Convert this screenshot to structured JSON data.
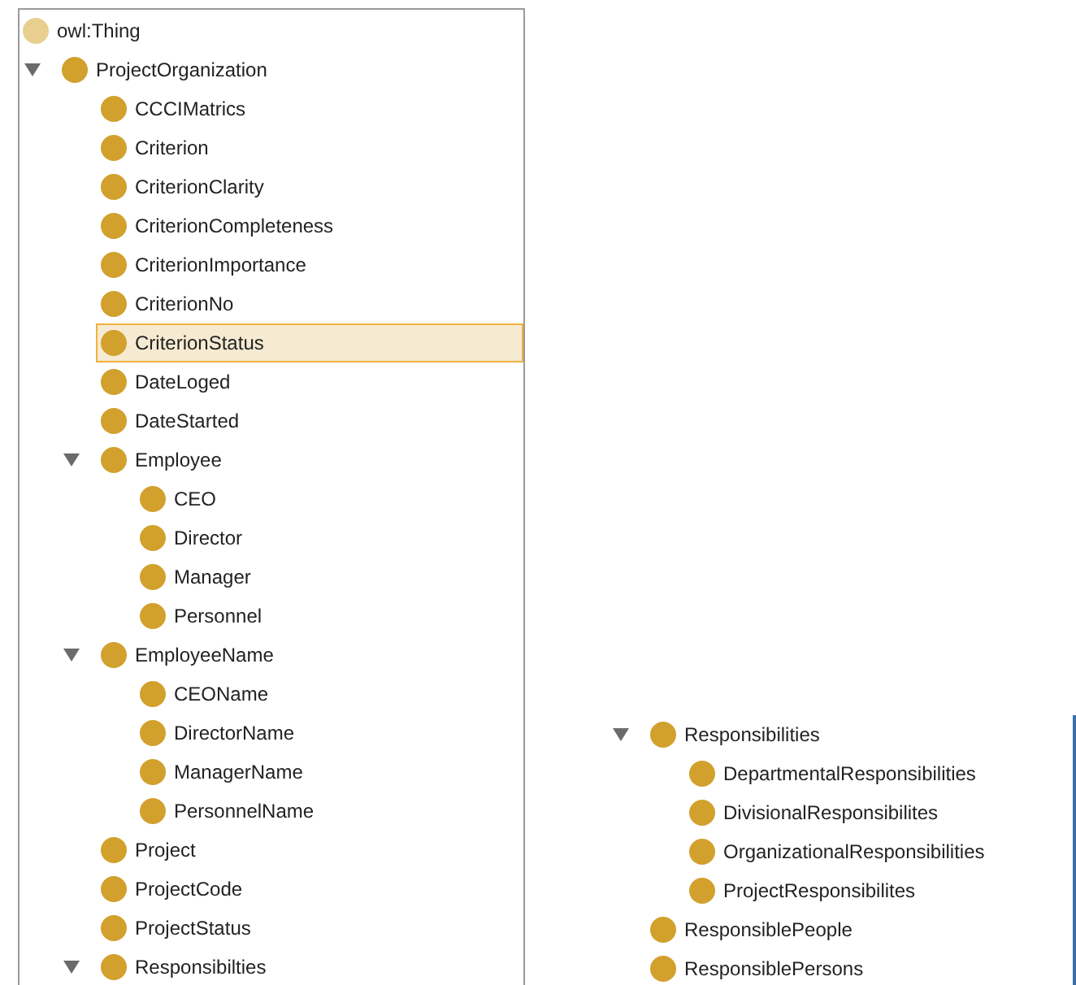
{
  "class_tree": [
    {
      "label": "owl:Thing",
      "kind": "root",
      "selected": false
    },
    {
      "label": "ProjectOrganization",
      "kind": "class",
      "selected": false,
      "expanded": true,
      "children": [
        {
          "label": "CCCIMatrics",
          "kind": "class",
          "selected": false
        },
        {
          "label": "Criterion",
          "kind": "class",
          "selected": false
        },
        {
          "label": "CriterionClarity",
          "kind": "class",
          "selected": false
        },
        {
          "label": "CriterionCompleteness",
          "kind": "class",
          "selected": false
        },
        {
          "label": "CriterionImportance",
          "kind": "class",
          "selected": false
        },
        {
          "label": "CriterionNo",
          "kind": "class",
          "selected": false
        },
        {
          "label": "CriterionStatus",
          "kind": "class",
          "selected": true
        },
        {
          "label": "DateLoged",
          "kind": "class",
          "selected": false
        },
        {
          "label": "DateStarted",
          "kind": "class",
          "selected": false
        },
        {
          "label": "Employee",
          "kind": "class",
          "selected": false,
          "expanded": true,
          "children": [
            {
              "label": "CEO",
              "kind": "class",
              "selected": false
            },
            {
              "label": "Director",
              "kind": "class",
              "selected": false
            },
            {
              "label": "Manager",
              "kind": "class",
              "selected": false
            },
            {
              "label": "Personnel",
              "kind": "class",
              "selected": false
            }
          ]
        },
        {
          "label": "EmployeeName",
          "kind": "class",
          "selected": false,
          "expanded": true,
          "children": [
            {
              "label": "CEOName",
              "kind": "class",
              "selected": false
            },
            {
              "label": "DirectorName",
              "kind": "class",
              "selected": false
            },
            {
              "label": "ManagerName",
              "kind": "class",
              "selected": false
            },
            {
              "label": "PersonnelName",
              "kind": "class",
              "selected": false
            }
          ]
        },
        {
          "label": "Project",
          "kind": "class",
          "selected": false
        },
        {
          "label": "ProjectCode",
          "kind": "class",
          "selected": false
        },
        {
          "label": "ProjectStatus",
          "kind": "class",
          "selected": false
        },
        {
          "label": "Responsibilties",
          "kind": "class",
          "selected": false,
          "expanded": true
        }
      ]
    }
  ],
  "continued_tree": [
    {
      "label": "Responsibilities",
      "kind": "class",
      "selected": false,
      "expanded": true,
      "children": [
        {
          "label": "DepartmentalResponsibilities",
          "kind": "class",
          "selected": false
        },
        {
          "label": "DivisionalResponsibilites",
          "kind": "class",
          "selected": false
        },
        {
          "label": "OrganizationalResponsibilities",
          "kind": "class",
          "selected": false
        },
        {
          "label": "ProjectResponsibilites",
          "kind": "class",
          "selected": false
        }
      ]
    },
    {
      "label": "ResponsiblePeople",
      "kind": "class",
      "selected": false
    },
    {
      "label": "ResponsiblePersons",
      "kind": "class",
      "selected": false
    }
  ]
}
